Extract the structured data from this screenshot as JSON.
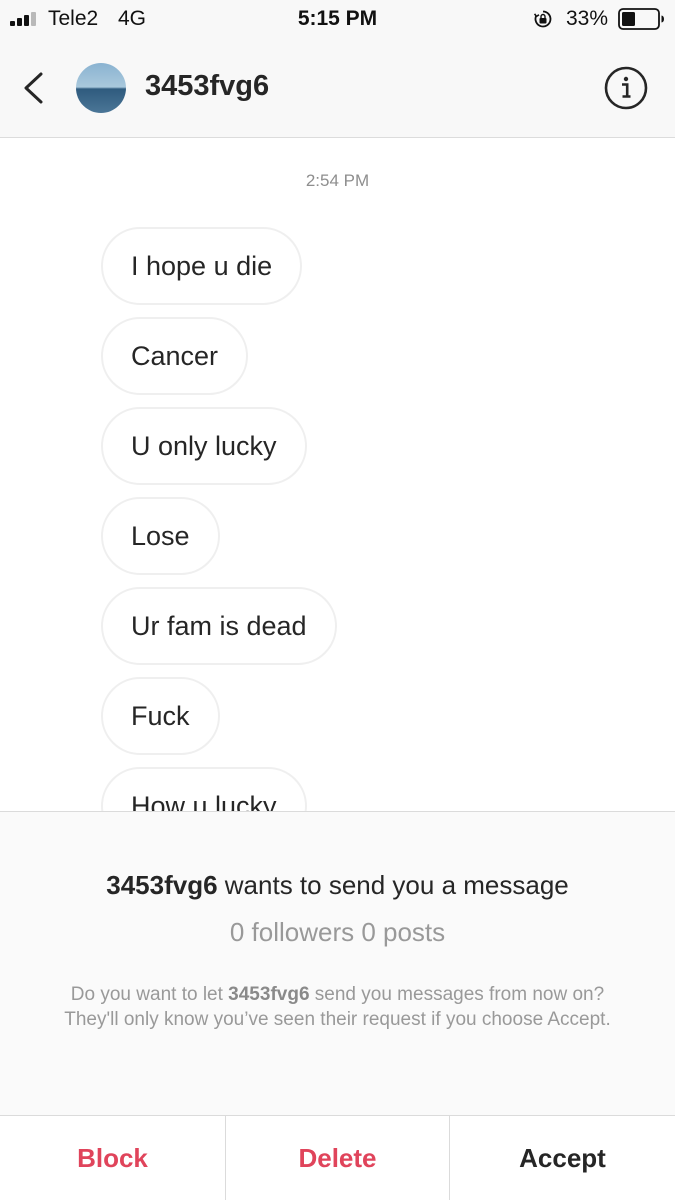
{
  "status_bar": {
    "carrier": "Tele2",
    "network": "4G",
    "time": "5:15 PM",
    "battery_percent": "33%",
    "icons": [
      "signal-icon",
      "orientation-lock-icon",
      "battery-icon"
    ]
  },
  "header": {
    "back_icon": "chevron-left-icon",
    "username": "3453fvg6",
    "info_icon": "info-icon"
  },
  "thread": {
    "timestamp": "2:54 PM",
    "messages": [
      "I hope u die",
      "Cancer",
      "U only lucky",
      "Lose",
      "Ur fam is dead",
      "Fuck",
      "How u lucky"
    ]
  },
  "request": {
    "username": "3453fvg6",
    "title_suffix": " wants to send you a message",
    "stats": "0 followers 0 posts",
    "desc_prefix": "Do you want to let ",
    "desc_username": "3453fvg6",
    "desc_suffix": " send you messages from now on? They'll only know you’ve seen their request if you choose Accept.",
    "actions": {
      "block": "Block",
      "delete": "Delete",
      "accept": "Accept"
    }
  },
  "colors": {
    "danger": "#e0445b",
    "text": "#262626",
    "muted": "#999999",
    "bar_bg": "#f8f8f8"
  }
}
